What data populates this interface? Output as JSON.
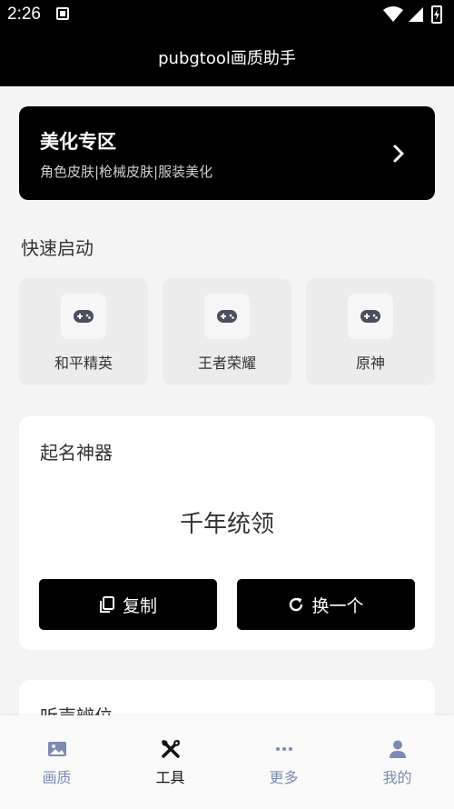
{
  "status_bar": {
    "time": "2:26"
  },
  "header": {
    "title": "pubgtool画质助手"
  },
  "beauty_zone": {
    "title": "美化专区",
    "subtitle": "角色皮肤|枪械皮肤|服装美化"
  },
  "quick_launch": {
    "title": "快速启动",
    "items": [
      {
        "label": "和平精英",
        "icon": "gamepad-icon"
      },
      {
        "label": "王者荣耀",
        "icon": "gamepad-icon"
      },
      {
        "label": "原神",
        "icon": "gamepad-icon"
      }
    ]
  },
  "name_generator": {
    "title": "起名神器",
    "generated_name": "千年统领",
    "copy_label": "复制",
    "refresh_label": "换一个"
  },
  "next_card": {
    "title": "听声辨位"
  },
  "tabs": [
    {
      "label": "画质",
      "icon": "image-icon",
      "active": false
    },
    {
      "label": "工具",
      "icon": "tools-icon",
      "active": true
    },
    {
      "label": "更多",
      "icon": "more-icon",
      "active": false
    },
    {
      "label": "我的",
      "icon": "user-icon",
      "active": false
    }
  ],
  "colors": {
    "active_tab": "#111111",
    "inactive_tab": "#7b8bb0",
    "primary": "#000000"
  }
}
